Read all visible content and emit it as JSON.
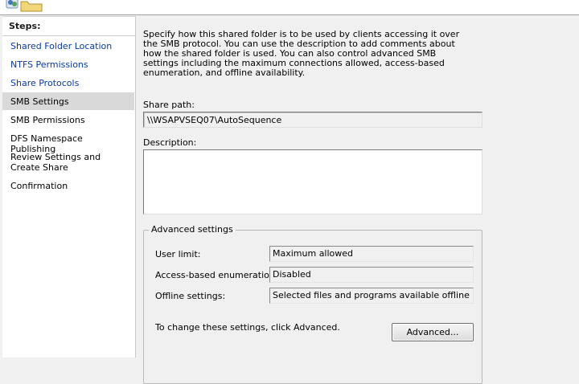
{
  "wizard": {
    "steps_title": "Steps:",
    "steps": [
      {
        "label": "Shared Folder Location",
        "state": "link"
      },
      {
        "label": "NTFS Permissions",
        "state": "link"
      },
      {
        "label": "Share Protocols",
        "state": "link"
      },
      {
        "label": "SMB Settings",
        "state": "active"
      },
      {
        "label": "SMB Permissions",
        "state": "plain"
      },
      {
        "label": "DFS Namespace Publishing",
        "state": "plain"
      },
      {
        "label": "Review Settings and Create Share",
        "state": "plain"
      },
      {
        "label": "Confirmation",
        "state": "plain"
      }
    ]
  },
  "main": {
    "intro": "Specify how this shared folder is to be used by clients accessing it over the SMB protocol. You can use the description to add comments about how the shared folder is used. You can also control advanced SMB settings including the maximum connections allowed, access-based enumeration, and offline availability.",
    "share_path_label": "Share path:",
    "share_path_value": "\\\\WSAPVSEQ07\\AutoSequence",
    "description_label": "Description:",
    "description_value": "",
    "advanced": {
      "title": "Advanced settings",
      "user_limit_label": "User limit:",
      "user_limit_value": "Maximum allowed",
      "abe_label": "Access-based enumeration:",
      "abe_value": "Disabled",
      "offline_label": "Offline settings:",
      "offline_value": "Selected files and programs available offline",
      "change_note": "To change these settings, click Advanced.",
      "advanced_button": "Advanced..."
    }
  },
  "colors": {
    "link": "#0a3aa6",
    "active_step_bg": "#d9d9d9",
    "window_bg": "#f0f0f0"
  },
  "icons": {
    "header": "share-folder-icon"
  }
}
